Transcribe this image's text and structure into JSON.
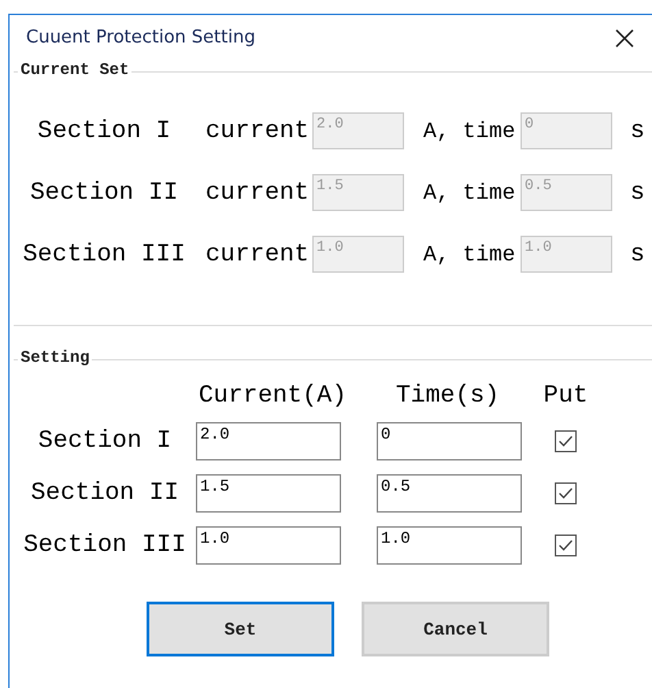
{
  "window": {
    "title": "Cuuent Protection Setting"
  },
  "current_set": {
    "title": "Current Set",
    "rows": [
      {
        "section": "Section I",
        "current_label": "current",
        "current": "2.0",
        "time_label": "A, time",
        "time": "0",
        "unit": "s"
      },
      {
        "section": "Section II",
        "current_label": "current",
        "current": "1.5",
        "time_label": "A, time",
        "time": "0.5",
        "unit": "s"
      },
      {
        "section": "Section III",
        "current_label": "current",
        "current": "1.0",
        "time_label": "A, time",
        "time": "1.0",
        "unit": "s"
      }
    ]
  },
  "setting": {
    "title": "Setting",
    "columns": [
      "Current(A)",
      "Time(s)",
      "Put"
    ],
    "rows": [
      {
        "section": "Section I",
        "current": "2.0",
        "time": "0",
        "checked": true
      },
      {
        "section": "Section II",
        "current": "1.5",
        "time": "0.5",
        "checked": true
      },
      {
        "section": "Section III",
        "current": "1.0",
        "time": "1.0",
        "checked": true
      }
    ]
  },
  "buttons": [
    {
      "label": "Set",
      "focused": true
    },
    {
      "label": "Cancel",
      "focused": false
    }
  ]
}
